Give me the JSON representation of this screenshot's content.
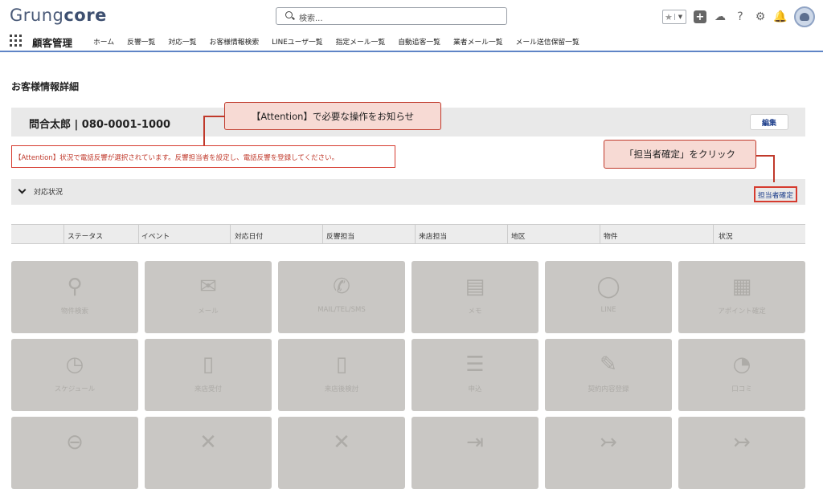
{
  "header": {
    "logo_light": "Grung",
    "logo_bold": "core",
    "search_placeholder": "検索...",
    "icons": [
      "star-icon",
      "plus-icon",
      "cloud-icon",
      "help-icon",
      "gear-icon",
      "bell-icon",
      "avatar"
    ]
  },
  "nav": {
    "app_name": "顧客管理",
    "items": [
      "ホーム",
      "反響一覧",
      "対応一覧",
      "お客様情報検索",
      "LINEユーザ一覧",
      "指定メール一覧",
      "自動追客一覧",
      "業者メール一覧",
      "メール送信保留一覧"
    ]
  },
  "page": {
    "title": "お客様情報詳細",
    "record_name": "問合太郎 | 080-0001-1000",
    "edit_label": "編集",
    "attention_message": "【Attention】状況で電話反響が選択されています。反響担当者を設定し、電話反響を登録してください。",
    "status_section_label": "対応状況",
    "confirm_link": "担当者確定"
  },
  "table": {
    "columns": [
      "ステータス",
      "イベント",
      "対応日付",
      "反響担当",
      "来店担当",
      "地区",
      "物件",
      "状況"
    ]
  },
  "tiles": [
    {
      "label": "物件検索",
      "icon": "search-icon"
    },
    {
      "label": "メール",
      "icon": "mail-icon"
    },
    {
      "label": "MAIL/TEL/SMS",
      "icon": "phone-icon"
    },
    {
      "label": "メモ",
      "icon": "memo-icon"
    },
    {
      "label": "LINE",
      "icon": "line-icon"
    },
    {
      "label": "アポイント確定",
      "icon": "calendar-icon"
    },
    {
      "label": "スケジュール",
      "icon": "clock-icon"
    },
    {
      "label": "来店受付",
      "icon": "door-icon"
    },
    {
      "label": "来店後検討",
      "icon": "door-icon"
    },
    {
      "label": "申込",
      "icon": "checklist-icon"
    },
    {
      "label": "契約内容登録",
      "icon": "contract-icon"
    },
    {
      "label": "口コミ",
      "icon": "chat-icon"
    },
    {
      "label": "",
      "icon": "minus-circle-icon"
    },
    {
      "label": "",
      "icon": "x-icon"
    },
    {
      "label": "",
      "icon": "x-icon"
    },
    {
      "label": "",
      "icon": "exit-icon"
    },
    {
      "label": "",
      "icon": "forward-icon"
    },
    {
      "label": "",
      "icon": "forward-icon"
    }
  ],
  "callouts": {
    "attention": "【Attention】で必要な操作をお知らせ",
    "confirm": "「担当者確定」をクリック"
  },
  "colors": {
    "accent_red": "#c0392b",
    "link_blue": "#1b3d8a",
    "nav_underline": "#5f84c6",
    "tile_gray": "#c9c7c4"
  }
}
